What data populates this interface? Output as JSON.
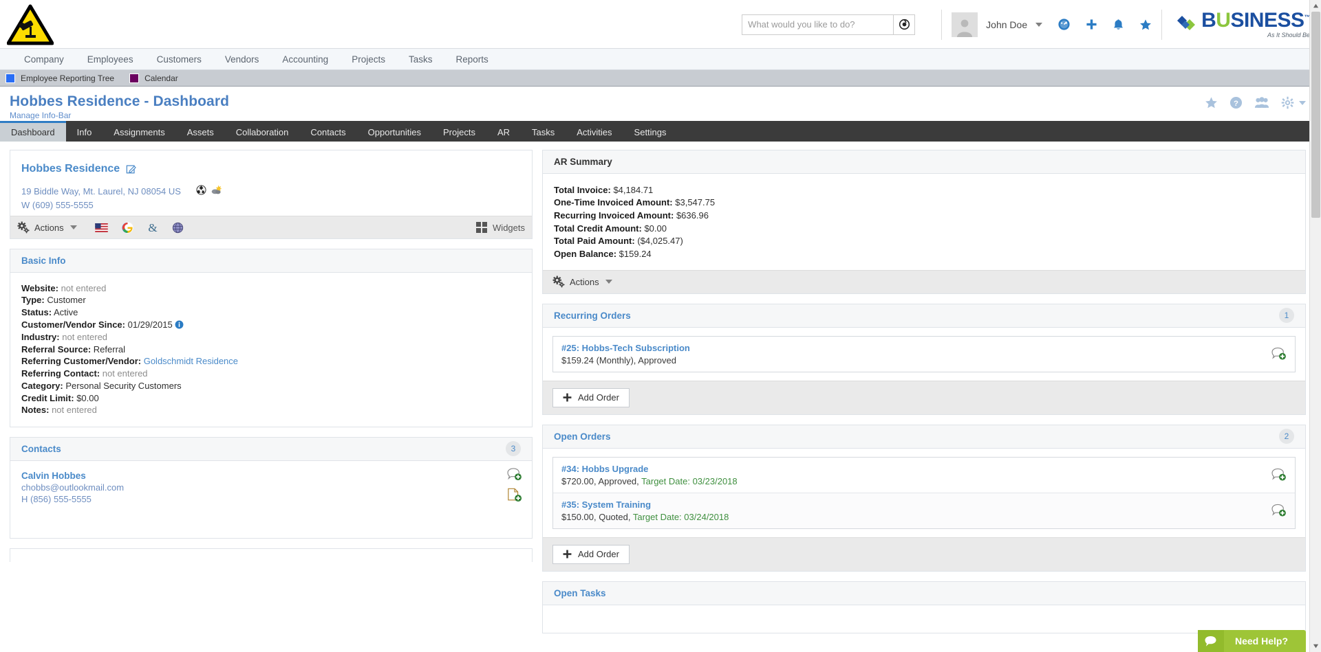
{
  "header": {
    "logo_alt": "security-camera-warning-logo",
    "search": {
      "placeholder": "What would you like to do?",
      "value": "",
      "button_icon": "search-target-icon"
    },
    "user": {
      "name": "John Doe",
      "avatar_icon": "user-avatar-icon"
    },
    "icons": [
      {
        "name": "dashboard-gauge-icon",
        "glyph": "gauge"
      },
      {
        "name": "add-plus-icon",
        "glyph": "plus"
      },
      {
        "name": "notifications-bell-icon",
        "glyph": "bell"
      },
      {
        "name": "favorites-star-icon",
        "glyph": "star"
      }
    ],
    "brand": {
      "main_b": "B",
      "main_u": "U",
      "main_rest": "SINESS",
      "trademark": "™",
      "tagline": "As It Should Be"
    }
  },
  "mainnav": {
    "items": [
      "Company",
      "Employees",
      "Customers",
      "Vendors",
      "Accounting",
      "Projects",
      "Tasks",
      "Reports"
    ]
  },
  "infobar": {
    "chips": [
      {
        "label": "Employee Reporting Tree",
        "color": "#2a6ef5"
      },
      {
        "label": "Calendar",
        "color": "#6b0060"
      }
    ]
  },
  "page": {
    "title": "Hobbes Residence - Dashboard",
    "subtitle": "Manage Info-Bar",
    "icons": [
      {
        "name": "favorite-star-icon"
      },
      {
        "name": "help-question-icon"
      },
      {
        "name": "users-group-icon"
      },
      {
        "name": "settings-gear-icon"
      }
    ]
  },
  "tabs": {
    "active": "Dashboard",
    "items": [
      "Dashboard",
      "Info",
      "Assignments",
      "Assets",
      "Collaboration",
      "Contacts",
      "Opportunities",
      "Projects",
      "AR",
      "Tasks",
      "Activities",
      "Settings"
    ]
  },
  "customer": {
    "name": "Hobbes Residence",
    "edit_icon": "edit-pencil-icon",
    "address": "19 Biddle Way, Mt. Laurel, NJ 08054 US",
    "address_icons": [
      {
        "name": "map-globe-icon"
      },
      {
        "name": "weather-cloud-sun-icon"
      }
    ],
    "phone": "W (609) 555-5555",
    "toolbar": {
      "actions_label": "Actions",
      "actions_icon": "gears-icon",
      "caret": "▾",
      "mini_icons": [
        {
          "name": "us-flag-icon"
        },
        {
          "name": "google-g-icon"
        },
        {
          "name": "ampersand-link-icon"
        },
        {
          "name": "globe-web-icon"
        }
      ],
      "widgets_label": "Widgets",
      "widgets_icon": "grid-squares-icon"
    }
  },
  "basic_info": {
    "title": "Basic Info",
    "rows": [
      {
        "label": "Website:",
        "value": "not entered",
        "style": "muted"
      },
      {
        "label": "Type:",
        "value": "Customer",
        "style": "normal"
      },
      {
        "label": "Status:",
        "value": "Active",
        "style": "normal"
      },
      {
        "label": "Customer/Vendor Since:",
        "value": "01/29/2015",
        "style": "normal",
        "info_icon": "info-circle-icon"
      },
      {
        "label": "Industry:",
        "value": "not entered",
        "style": "muted"
      },
      {
        "label": "Referral Source:",
        "value": "Referral",
        "style": "normal"
      },
      {
        "label": "Referring Customer/Vendor:",
        "value": "Goldschmidt Residence",
        "style": "link"
      },
      {
        "label": "Referring Contact:",
        "value": "not entered",
        "style": "muted"
      },
      {
        "label": "Category:",
        "value": "Personal Security Customers",
        "style": "normal"
      },
      {
        "label": "Credit Limit:",
        "value": "$0.00",
        "style": "normal"
      },
      {
        "label": "Notes:",
        "value": "not entered",
        "style": "muted"
      }
    ]
  },
  "contacts": {
    "title": "Contacts",
    "count": "3",
    "items": [
      {
        "name": "Calvin Hobbes",
        "email": "chobbs@outlookmail.com",
        "phone": "H (856) 555-5555",
        "icons": [
          {
            "name": "add-note-bubble-icon"
          },
          {
            "name": "add-document-icon"
          }
        ]
      }
    ]
  },
  "ar_summary": {
    "title": "AR Summary",
    "rows": [
      {
        "label": "Total Invoice:",
        "value": "$4,184.71"
      },
      {
        "label": "One-Time Invoiced Amount:",
        "value": "$3,547.75"
      },
      {
        "label": "Recurring Invoiced Amount:",
        "value": "$636.96"
      },
      {
        "label": "Total Credit Amount:",
        "value": "$0.00"
      },
      {
        "label": "Total Paid Amount:",
        "value": "($4,025.47)"
      },
      {
        "label": "Open Balance:",
        "value": "$159.24"
      }
    ],
    "actions_label": "Actions",
    "actions_icon": "gears-icon"
  },
  "recurring_orders": {
    "title": "Recurring Orders",
    "count": "1",
    "items": [
      {
        "title": "#25: Hobbs-Tech Subscription",
        "meta": "$159.24 (Monthly), Approved",
        "icon": "add-note-bubble-icon"
      }
    ],
    "add_label": "Add Order",
    "add_icon": "plus-icon"
  },
  "open_orders": {
    "title": "Open Orders",
    "count": "2",
    "items": [
      {
        "title": "#34: Hobbs Upgrade",
        "meta_main": "$720.00, Approved, ",
        "meta_green": "Target Date: 03/23/2018",
        "icon": "add-note-bubble-icon"
      },
      {
        "title": "#35: System Training",
        "meta_main": "$150.00, Quoted, ",
        "meta_green": "Target Date: 03/24/2018",
        "icon": "add-note-bubble-icon"
      }
    ],
    "add_label": "Add Order",
    "add_icon": "plus-icon"
  },
  "open_tasks": {
    "title": "Open Tasks"
  },
  "need_help": {
    "label": "Need Help?",
    "icon": "chat-bubble-icon"
  }
}
